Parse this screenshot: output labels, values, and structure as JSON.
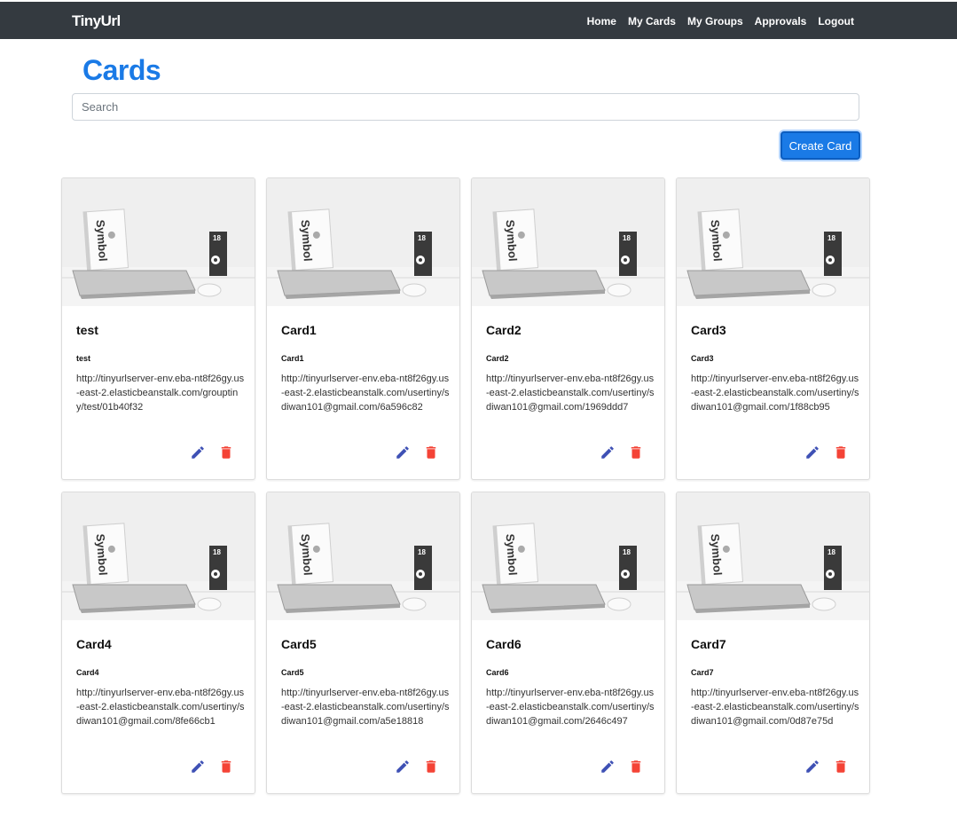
{
  "navbar": {
    "brand": "TinyUrl",
    "links": [
      "Home",
      "My Cards",
      "My Groups",
      "Approvals",
      "Logout"
    ]
  },
  "page": {
    "title": "Cards",
    "search_placeholder": "Search",
    "create_button": "Create Card"
  },
  "colors": {
    "accent": "#1a7ae6",
    "navbar": "#343a40",
    "edit": "#3f51b5",
    "delete": "#f44336"
  },
  "cards": [
    {
      "title": "test",
      "subtitle": "test",
      "url": "http://tinyurlserver-env.eba-nt8f26gy.us-east-2.elasticbeanstalk.com/grouptiny/test/01b40f32"
    },
    {
      "title": "Card1",
      "subtitle": "Card1",
      "url": "http://tinyurlserver-env.eba-nt8f26gy.us-east-2.elasticbeanstalk.com/usertiny/sdiwan101@gmail.com/6a596c82"
    },
    {
      "title": "Card2",
      "subtitle": "Card2",
      "url": "http://tinyurlserver-env.eba-nt8f26gy.us-east-2.elasticbeanstalk.com/usertiny/sdiwan101@gmail.com/1969ddd7"
    },
    {
      "title": "Card3",
      "subtitle": "Card3",
      "url": "http://tinyurlserver-env.eba-nt8f26gy.us-east-2.elasticbeanstalk.com/usertiny/sdiwan101@gmail.com/1f88cb95"
    },
    {
      "title": "Card4",
      "subtitle": "Card4",
      "url": "http://tinyurlserver-env.eba-nt8f26gy.us-east-2.elasticbeanstalk.com/usertiny/sdiwan101@gmail.com/8fe66cb1"
    },
    {
      "title": "Card5",
      "subtitle": "Card5",
      "url": "http://tinyurlserver-env.eba-nt8f26gy.us-east-2.elasticbeanstalk.com/usertiny/sdiwan101@gmail.com/a5e18818"
    },
    {
      "title": "Card6",
      "subtitle": "Card6",
      "url": "http://tinyurlserver-env.eba-nt8f26gy.us-east-2.elasticbeanstalk.com/usertiny/sdiwan101@gmail.com/2646c497"
    },
    {
      "title": "Card7",
      "subtitle": "Card7",
      "url": "http://tinyurlserver-env.eba-nt8f26gy.us-east-2.elasticbeanstalk.com/usertiny/sdiwan101@gmail.com/0d87e75d"
    }
  ],
  "card_image": {
    "book_text": "Symbol",
    "badge_text": "18"
  }
}
